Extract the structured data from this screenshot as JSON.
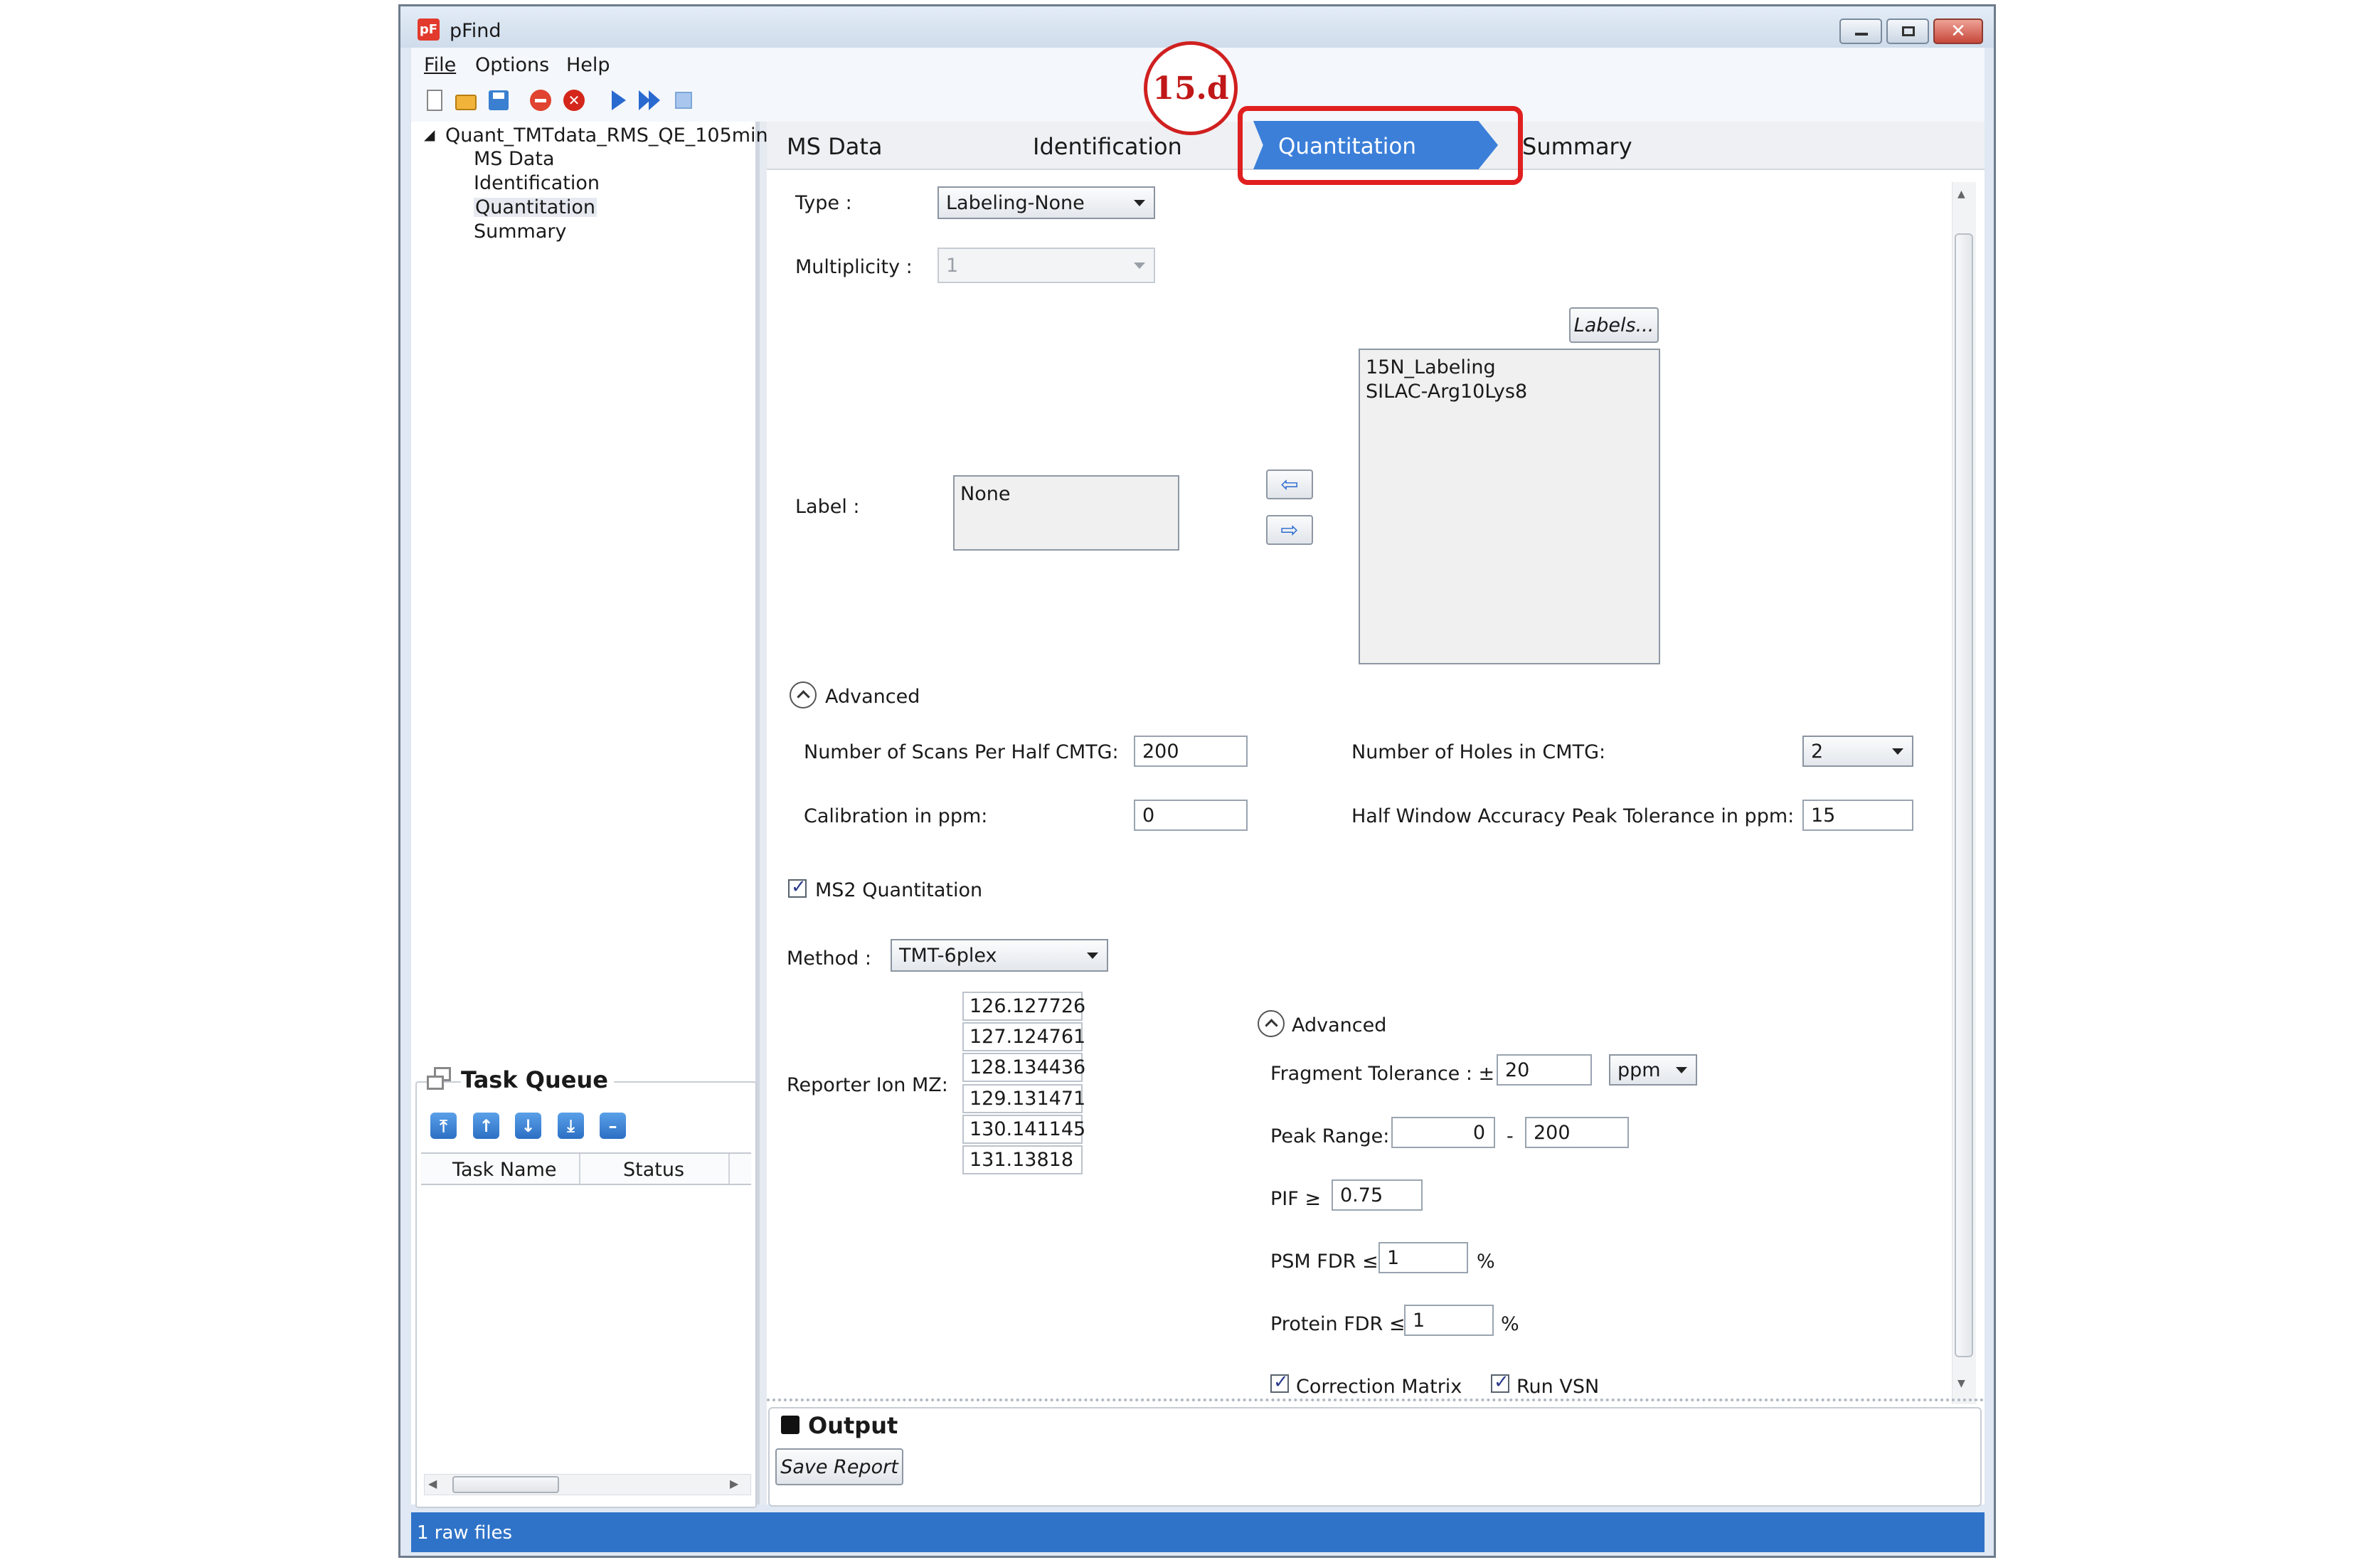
{
  "window": {
    "title": "pFind"
  },
  "menu": {
    "file": "File",
    "options": "Options",
    "help": "Help"
  },
  "tree": {
    "root": "Quant_TMTdata_RMS_QE_105min",
    "items": [
      "MS Data",
      "Identification",
      "Quantitation",
      "Summary"
    ]
  },
  "tabs": {
    "ms_data": "MS Data",
    "identification": "Identification",
    "quantitation": "Quantitation",
    "summary": "Summary"
  },
  "annotation": "15.d",
  "quant": {
    "type_label": "Type :",
    "type_value": "Labeling-None",
    "multiplicity_label": "Multiplicity :",
    "multiplicity_value": "1",
    "labels_button": "Labels...",
    "label_label": "Label :",
    "selected_labels": [
      "None"
    ],
    "available_labels": [
      "15N_Labeling",
      "SILAC-Arg10Lys8"
    ],
    "advanced_label": "Advanced",
    "scans_label": "Number of Scans Per Half CMTG:",
    "scans_value": "200",
    "holes_label": "Number of Holes in CMTG:",
    "holes_value": "2",
    "calibration_label": "Calibration in ppm:",
    "calibration_value": "0",
    "half_window_label": "Half Window Accuracy Peak Tolerance in ppm:",
    "half_window_value": "15",
    "ms2_label": "MS2 Quantitation",
    "method_label": "Method :",
    "method_value": "TMT-6plex",
    "reporter_label": "Reporter Ion MZ:",
    "reporter_ions": [
      "126.127726",
      "127.124761",
      "128.134436",
      "129.131471",
      "130.141145",
      "131.13818"
    ],
    "advanced2_label": "Advanced",
    "fragment_label": "Fragment Tolerance : ±",
    "fragment_value": "20",
    "fragment_unit": "ppm",
    "peak_range_label": "Peak Range:",
    "peak_range_min": "0",
    "peak_range_sep": "-",
    "peak_range_max": "200",
    "pif_label": "PIF ≥",
    "pif_value": "0.75",
    "psm_fdr_label": "PSM FDR ≤",
    "psm_fdr_value": "1",
    "psm_fdr_unit": "%",
    "protein_fdr_label": "Protein FDR ≤",
    "protein_fdr_value": "1",
    "protein_fdr_unit": "%",
    "correction_label": "Correction Matrix",
    "run_vsn_label": "Run VSN"
  },
  "task_queue": {
    "title": "Task Queue",
    "col_name": "Task Name",
    "col_status": "Status"
  },
  "output": {
    "title": "Output",
    "save_report": "Save Report"
  },
  "status": {
    "text": "1 raw files"
  },
  "colors": {
    "accent": "#3b7fd9",
    "statusbar": "#2f73c8",
    "highlight": "#e02020"
  }
}
